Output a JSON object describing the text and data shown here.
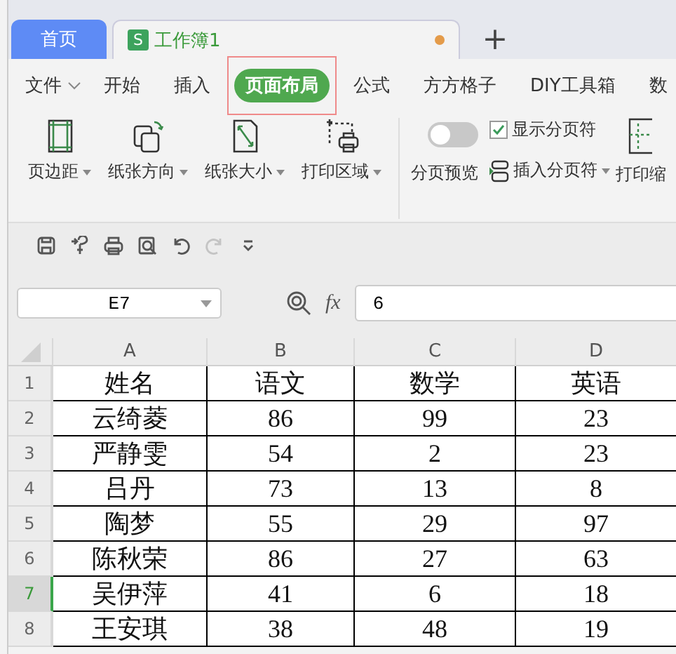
{
  "tabs": [
    {
      "label": "首页",
      "kind": "home",
      "selected": false
    },
    {
      "label": "工作簿1",
      "kind": "doc",
      "selected": true,
      "badge": "S",
      "unsaved": true
    }
  ],
  "new_tab": "+",
  "menu": {
    "file": "文件",
    "items": [
      {
        "label": "开始",
        "selected": false
      },
      {
        "label": "插入",
        "selected": false
      },
      {
        "label": "页面布局",
        "selected": true,
        "highlighted": true
      },
      {
        "label": "公式",
        "selected": false
      },
      {
        "label": "方方格子",
        "selected": false
      },
      {
        "label": "DIY工具箱",
        "selected": false
      },
      {
        "label": "数",
        "selected": false
      }
    ]
  },
  "ribbon": {
    "buttons": [
      {
        "label": "页边距",
        "kind": "margins"
      },
      {
        "label": "纸张方向",
        "kind": "orientation"
      },
      {
        "label": "纸张大小",
        "kind": "size"
      },
      {
        "label": "打印区域",
        "kind": "print-area"
      }
    ],
    "page_break_preview": {
      "label": "分页预览",
      "on": false
    },
    "show_page_breaks": {
      "label": "显示分页符",
      "checked": true
    },
    "insert_page_break": "插入分页符",
    "print_scale": "打印缩"
  },
  "quick_toolbar": [
    {
      "kind": "save",
      "disabled": false
    },
    {
      "kind": "format",
      "disabled": false
    },
    {
      "kind": "print",
      "disabled": false
    },
    {
      "kind": "preview",
      "disabled": false
    },
    {
      "kind": "undo",
      "disabled": false
    },
    {
      "kind": "redo",
      "disabled": true
    },
    {
      "kind": "more",
      "disabled": false
    }
  ],
  "name_box": "E7",
  "fx": "fx",
  "formula": "6",
  "columns": [
    "A",
    "B",
    "C",
    "D"
  ],
  "rows": [
    {
      "number": "1",
      "selected": false,
      "cells": [
        "姓名",
        "语文",
        "数学",
        "英语"
      ]
    },
    {
      "number": "2",
      "selected": false,
      "cells": [
        "云绮菱",
        "86",
        "99",
        "23"
      ]
    },
    {
      "number": "3",
      "selected": false,
      "cells": [
        "严静雯",
        "54",
        "2",
        "23"
      ]
    },
    {
      "number": "4",
      "selected": false,
      "cells": [
        "吕丹",
        "73",
        "13",
        "8"
      ]
    },
    {
      "number": "5",
      "selected": false,
      "cells": [
        "陶梦",
        "55",
        "29",
        "97"
      ]
    },
    {
      "number": "6",
      "selected": false,
      "cells": [
        "陈秋荣",
        "86",
        "27",
        "63"
      ]
    },
    {
      "number": "7",
      "selected": true,
      "cells": [
        "吴伊萍",
        "41",
        "6",
        "18"
      ]
    },
    {
      "number": "8",
      "selected": false,
      "cells": [
        "王安琪",
        "38",
        "48",
        "19"
      ]
    }
  ]
}
